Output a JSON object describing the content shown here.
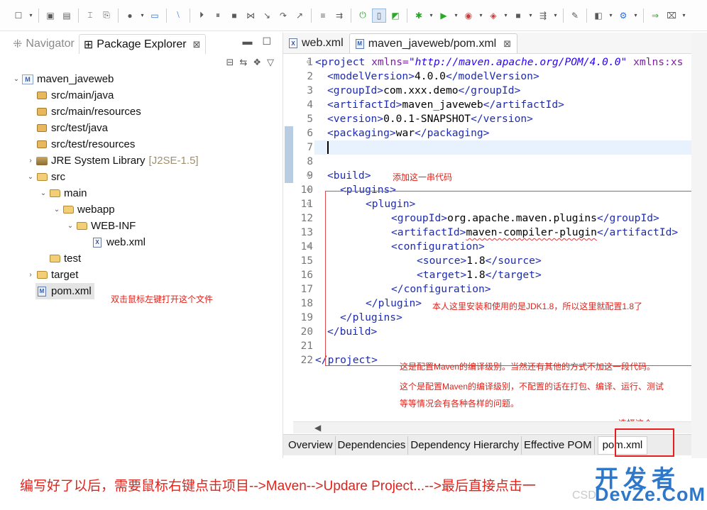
{
  "toolbar": {
    "icons": [
      "new-icon",
      "save-icon",
      "save-all-icon",
      "build-icon",
      "clean-icon",
      "profile-icon",
      "terminal-icon",
      "pin-icon",
      "skip-breakpoints-icon",
      "resume-icon",
      "suspend-icon",
      "terminate-icon",
      "disconnect-icon",
      "step-into-icon",
      "step-over-icon",
      "step-return-icon",
      "drop-to-frame-icon",
      "use-step-filters-icon",
      "server-start-icon",
      "toggle-markers-icon",
      "toggle-breadcrumb-icon",
      "debug-icon",
      "run-icon",
      "coverage-icon",
      "external-tools-icon",
      "stop-icon",
      "deploy-icon",
      "search-icon",
      "new-java-class-icon",
      "open-type-icon",
      "open-task-icon"
    ]
  },
  "left_panel": {
    "tabs": [
      {
        "label": "Navigator"
      },
      {
        "label": "Package Explorer"
      }
    ],
    "tab_close": "⊠",
    "tree": {
      "project": "maven_javeweb",
      "src_main_java": "src/main/java",
      "src_main_resources": "src/main/resources",
      "src_test_java": "src/test/java",
      "src_test_resources": "src/test/resources",
      "jre": "JRE System Library",
      "jre_version": "[J2SE-1.5]",
      "src": "src",
      "main": "main",
      "webapp": "webapp",
      "webinf": "WEB-INF",
      "webxml": "web.xml",
      "test": "test",
      "target": "target",
      "pom": "pom.xml"
    },
    "annotation": "双击鼠标左键打开这个文件"
  },
  "editor": {
    "tabs": [
      {
        "label": "web.xml"
      },
      {
        "label": "maven_javeweb/pom.xml"
      }
    ],
    "lines": {
      "l1_tag": "<project",
      "l1_attr": " xmlns=",
      "l1_val": "\"http://maven.apache.org/POM/4.0.0\"",
      "l1_attr2": " xmlns:xs",
      "l2_open": "<modelVersion>",
      "l2_text": "4.0.0",
      "l2_close": "</modelVersion>",
      "l3_open": "<groupId>",
      "l3_text": "com.xxx.demo",
      "l3_close": "</groupId>",
      "l4_open": "<artifactId>",
      "l4_text": "maven_javeweb",
      "l4_close": "</artifactId>",
      "l5_open": "<version>",
      "l5_text": "0.0.1-SNAPSHOT",
      "l5_close": "</version>",
      "l6_open": "<packaging>",
      "l6_text": "war",
      "l6_close": "</packaging>",
      "l9": "<build>",
      "l10": "<plugins>",
      "l11": "<plugin>",
      "l12_open": "<groupId>",
      "l12_text": "org.apache.maven.plugins",
      "l12_close": "</groupId>",
      "l13_open": "<artifactId>",
      "l13_text": "maven-compiler-plugin",
      "l13_close": "</artifactId>",
      "l14": "<configuration>",
      "l15_open": "<source>",
      "l15_text": "1.8",
      "l15_close": "</source>",
      "l16_open": "<target>",
      "l16_text": "1.8",
      "l16_close": "</target>",
      "l17": "</configuration>",
      "l18": "</plugin>",
      "l19": "</plugins>",
      "l20": "</build>",
      "l22": "</project>"
    },
    "line_numbers": [
      "1",
      "2",
      "3",
      "4",
      "5",
      "6",
      "7",
      "8",
      "9",
      "10",
      "11",
      "12",
      "13",
      "14",
      "15",
      "16",
      "17",
      "18",
      "19",
      "20",
      "21",
      "22"
    ],
    "notes": {
      "build": "添加这一串代码",
      "plugin": "本人这里安装和使用的是JDK1.8，所以这里就配置1.8了",
      "project1": "这是配置Maven的编译级别。当然还有其他的方式不加这一段代码。",
      "project2": "这个是配置Maven的编译级别，不配置的话在打包、编译、运行、测试",
      "project3": "等等情况会有各种各样的问题。",
      "select": "选择这个"
    },
    "scroll_left": "◀",
    "bottom_tabs": [
      {
        "label": "Overview"
      },
      {
        "label": "Dependencies"
      },
      {
        "label": "Dependency Hierarchy"
      },
      {
        "label": "Effective POM"
      },
      {
        "label": "pom.xml"
      }
    ]
  },
  "caption": "编写好了以后，需要鼠标右键点击项目-->Maven-->Updare Project...-->最后直接点击一",
  "watermark": {
    "cn": "开发者",
    "en": "DevZe.CoM",
    "csdn": "CSD"
  }
}
